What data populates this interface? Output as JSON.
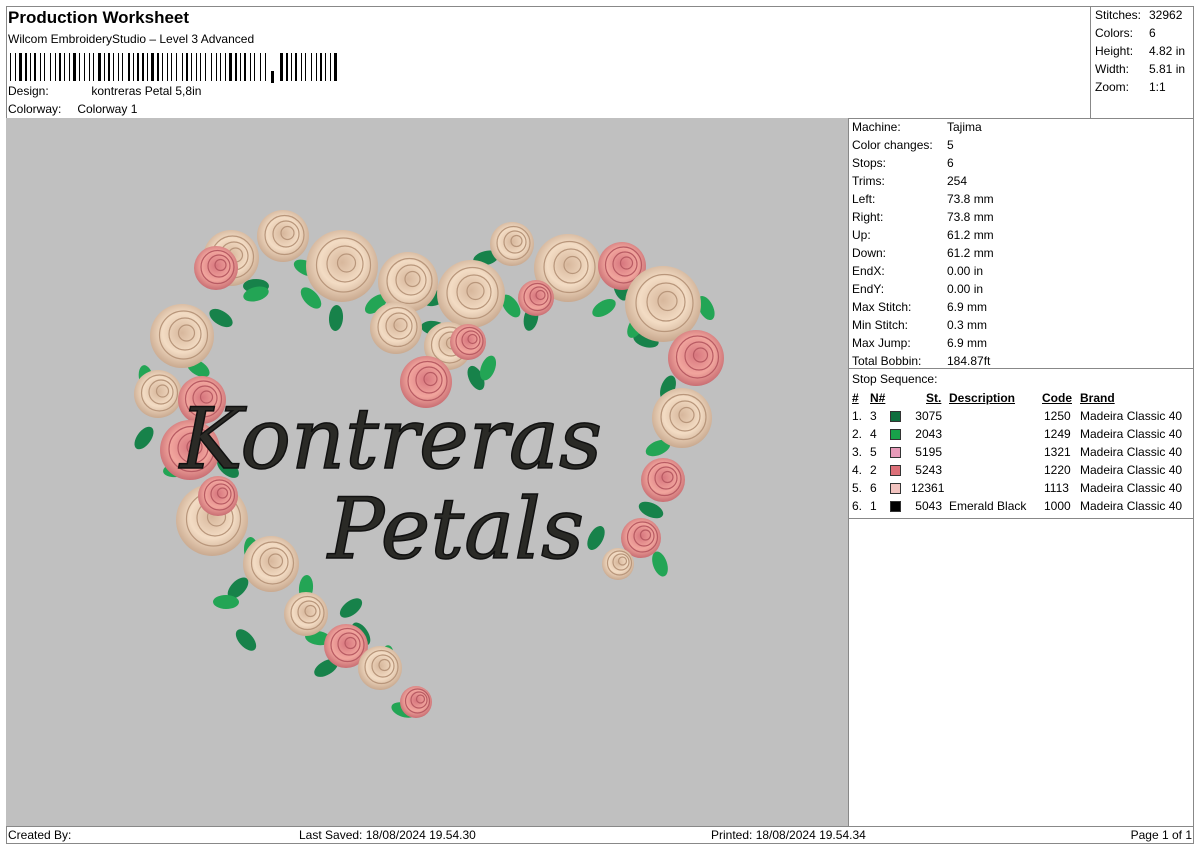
{
  "header": {
    "title": "Production Worksheet",
    "software": "Wilcom EmbroideryStudio – Level 3 Advanced",
    "design_label": "Design:",
    "design_value": "kontreras Petal 5,8in",
    "colorway_label": "Colorway:",
    "colorway_value": "Colorway 1"
  },
  "summary": {
    "stitches_label": "Stitches:",
    "stitches": "32962",
    "colors_label": "Colors:",
    "colors": "6",
    "height_label": "Height:",
    "height": "4.82 in",
    "width_label": "Width:",
    "width": "5.81 in",
    "zoom_label": "Zoom:",
    "zoom": "1:1"
  },
  "machine_info": [
    {
      "label": "Machine:",
      "value": "Tajima"
    },
    {
      "label": "Color changes:",
      "value": "5"
    },
    {
      "label": "Stops:",
      "value": "6"
    },
    {
      "label": "Trims:",
      "value": "254"
    },
    {
      "label": "Left:",
      "value": "73.8 mm"
    },
    {
      "label": "Right:",
      "value": "73.8 mm"
    },
    {
      "label": "Up:",
      "value": "61.2 mm"
    },
    {
      "label": "Down:",
      "value": "61.2 mm"
    },
    {
      "label": "EndX:",
      "value": "0.00 in"
    },
    {
      "label": "EndY:",
      "value": "0.00 in"
    },
    {
      "label": "Max Stitch:",
      "value": "6.9 mm"
    },
    {
      "label": "Min Stitch:",
      "value": "0.3 mm"
    },
    {
      "label": "Max Jump:",
      "value": "6.9 mm"
    },
    {
      "label": "Total Bobbin:",
      "value": "184.87ft"
    }
  ],
  "stop_sequence": {
    "caption": "Stop Sequence:",
    "headers": {
      "num": "#",
      "n": "N#",
      "st": "St.",
      "description": "Description",
      "code": "Code",
      "brand": "Brand"
    },
    "rows": [
      {
        "num": "1.",
        "n": "3",
        "color": "#0f6e3e",
        "st": "3075",
        "description": "",
        "code": "1250",
        "brand": "Madeira Classic 40"
      },
      {
        "num": "2.",
        "n": "4",
        "color": "#18a24a",
        "st": "2043",
        "description": "",
        "code": "1249",
        "brand": "Madeira Classic 40"
      },
      {
        "num": "3.",
        "n": "5",
        "color": "#e79bb9",
        "st": "5195",
        "description": "",
        "code": "1321",
        "brand": "Madeira Classic 40"
      },
      {
        "num": "4.",
        "n": "2",
        "color": "#dc6f78",
        "st": "5243",
        "description": "",
        "code": "1220",
        "brand": "Madeira Classic 40"
      },
      {
        "num": "5.",
        "n": "6",
        "color": "#f2c3bf",
        "st": "12361",
        "description": "",
        "code": "1113",
        "brand": "Madeira Classic 40"
      },
      {
        "num": "6.",
        "n": "1",
        "color": "#000000",
        "st": "5043",
        "description": "Emerald Black",
        "code": "1000",
        "brand": "Madeira Classic 40"
      }
    ]
  },
  "design_text": {
    "line1": "Kontreras",
    "line2": "Petals"
  },
  "footer": {
    "created": "Created By:",
    "saved": "Last Saved: 18/08/2024 19.54.30",
    "printed": "Printed: 18/08/2024 19.54.34",
    "page": "Page 1 of 1"
  }
}
